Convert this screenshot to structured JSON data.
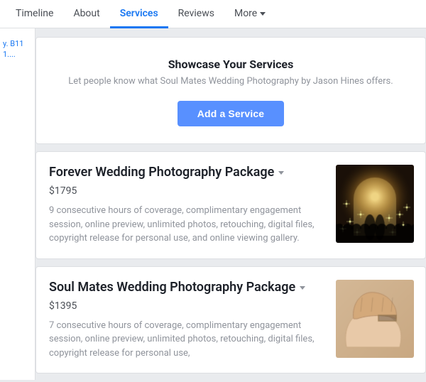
{
  "tabs": [
    {
      "id": "timeline",
      "label": "Timeline",
      "active": false
    },
    {
      "id": "about",
      "label": "About",
      "active": false
    },
    {
      "id": "services",
      "label": "Services",
      "active": true
    },
    {
      "id": "reviews",
      "label": "Reviews",
      "active": false
    },
    {
      "id": "more",
      "label": "More",
      "active": false,
      "hasDropdown": true
    }
  ],
  "sidebar": {
    "text": "y. B111...."
  },
  "showcase": {
    "title": "Showcase Your Services",
    "subtitle": "Let people know what Soul Mates Wedding Photography by Jason Hines offers.",
    "button_label": "Add a Service"
  },
  "services": [
    {
      "name": "Forever Wedding Photography Package",
      "price": "$1795",
      "description": "9 consecutive hours of coverage, complimentary engagement session, online preview, unlimited photos, retouching, digital files, copyright release for personal use, and online viewing gallery.",
      "image_hint": "wedding_sparklers"
    },
    {
      "name": "Soul Mates Wedding Photography Package",
      "price": "$1395",
      "description": "7 consecutive hours of coverage, complimentary engagement session, online preview, unlimited photos, retouching, digital files, copyright release for personal use,",
      "image_hint": "wedding_hands"
    }
  ]
}
